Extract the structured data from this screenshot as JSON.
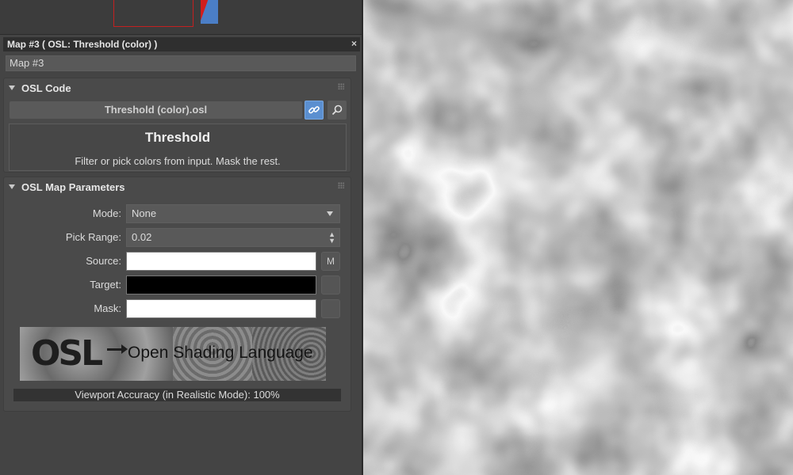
{
  "window": {
    "title": "Map #3  ( OSL: Threshold (color) )",
    "close_glyph": "×",
    "map_name": "Map #3"
  },
  "osl_code": {
    "header": "OSL Code",
    "file": "Threshold (color).osl",
    "link_icon": "link-icon",
    "find_icon": "magnifier-icon",
    "shader_title": "Threshold",
    "shader_description": "Filter or pick colors from input. Mask the rest."
  },
  "params": {
    "header": "OSL Map Parameters",
    "mode_label": "Mode:",
    "mode_value": "None",
    "pick_range_label": "Pick Range:",
    "pick_range_value": "0.02",
    "source_label": "Source:",
    "source_color": "#ffffff",
    "source_button": "M",
    "target_label": "Target:",
    "target_color": "#000000",
    "mask_label": "Mask:",
    "mask_color": "#ffffff",
    "banner_logo": "OSL",
    "banner_text": "Open Shading Language",
    "accuracy": "Viewport Accuracy (in Realistic Mode): 100%"
  },
  "colors": {
    "panel_bg": "#444444",
    "accent_blue": "#5b8fd0",
    "selection_red": "#c42020"
  }
}
